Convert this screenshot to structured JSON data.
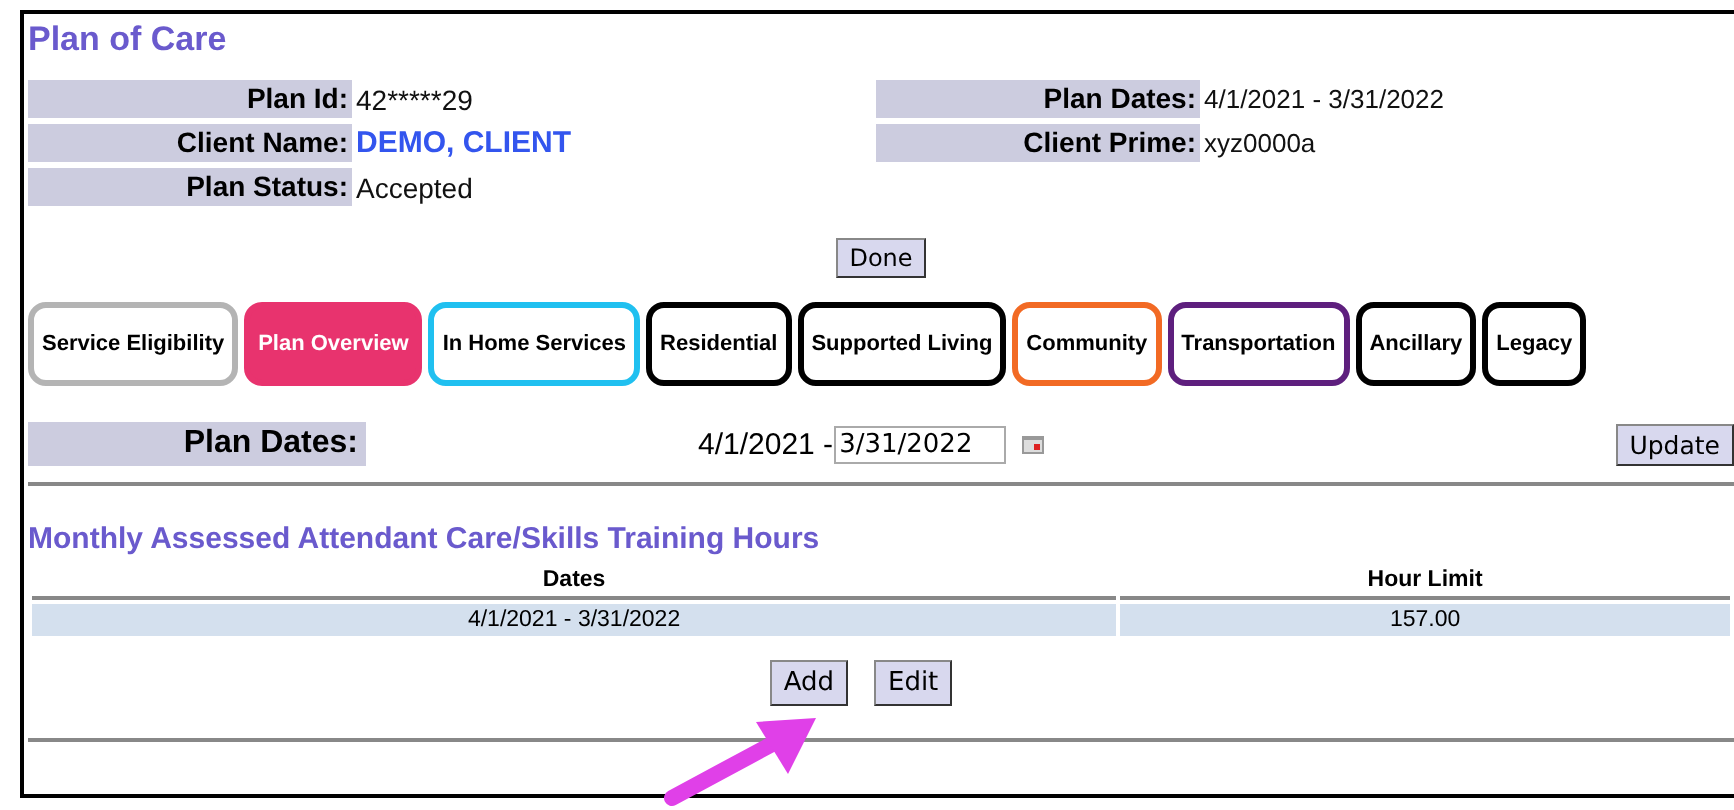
{
  "title": "Plan of Care",
  "info_left": [
    {
      "label": "Plan Id:",
      "value": "42*****29",
      "kind": "text"
    },
    {
      "label": "Client Name:",
      "value": "DEMO, CLIENT",
      "kind": "link"
    },
    {
      "label": "Plan Status:",
      "value": "Accepted",
      "kind": "text"
    }
  ],
  "info_right": [
    {
      "label": "Plan Dates:",
      "value": "4/1/2021 - 3/31/2022",
      "kind": "text"
    },
    {
      "label": "Client Prime:",
      "value": "xyz0000a",
      "kind": "text"
    }
  ],
  "done_button": "Done",
  "tabs": [
    {
      "label": "Service Eligibility",
      "selected": false,
      "color": "#b4b4b4"
    },
    {
      "label": "Plan Overview",
      "selected": true,
      "color": "#e8336e"
    },
    {
      "label": "In Home Services",
      "selected": false,
      "color": "#20c0f0"
    },
    {
      "label": "Residential",
      "selected": false,
      "color": "#000000"
    },
    {
      "label": "Supported Living",
      "selected": false,
      "color": "#000000"
    },
    {
      "label": "Community",
      "selected": false,
      "color": "#f26a24"
    },
    {
      "label": "Transportation",
      "selected": false,
      "color": "#5e1f7e"
    },
    {
      "label": "Ancillary",
      "selected": false,
      "color": "#000000"
    },
    {
      "label": "Legacy",
      "selected": false,
      "color": "#000000"
    }
  ],
  "plan_dates": {
    "label": "Plan Dates:",
    "start": "4/1/2021 - ",
    "end_value": "3/31/2022",
    "update_button": "Update"
  },
  "section_title": "Monthly Assessed Attendant Care/Skills Training Hours",
  "table": {
    "columns": [
      "Dates",
      "Hour Limit"
    ],
    "rows": [
      [
        "4/1/2021 - 3/31/2022",
        "157.00"
      ]
    ]
  },
  "buttons": [
    "Add",
    "Edit"
  ]
}
